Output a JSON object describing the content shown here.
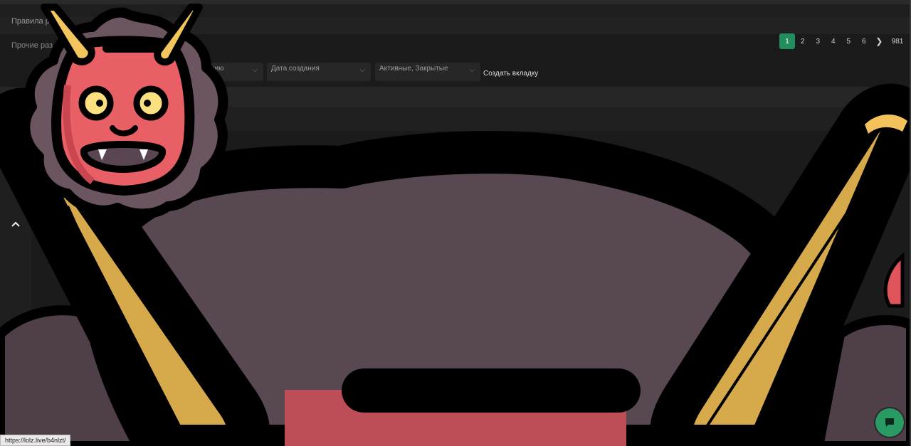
{
  "header": {
    "rules_label": "Правила ра",
    "sub_label": "Прочие раз"
  },
  "pagination": {
    "pages": [
      "1",
      "2",
      "3",
      "4",
      "5",
      "6"
    ],
    "next_glyph": "❯",
    "last_page": "981",
    "active_page": "1"
  },
  "filters": {
    "sort_partial": "нию",
    "date_label": "Дата создания",
    "state_label": "Активные, Закрытые",
    "create_tab": "Создать вкладку",
    "chevron": "⌵"
  },
  "status_bar": {
    "url": "https://lolz.live/b4nlzt/"
  },
  "icons": {
    "scroll_top": "chevron-up-icon",
    "chat": "chat-bubble-icon",
    "sticker": "oni-demon-mask-sticker"
  },
  "colors": {
    "accent_green": "#228e5d",
    "sticker_red": "#e0545c",
    "sticker_purple": "#5a4852",
    "sticker_gold": "#d6aa4b"
  }
}
